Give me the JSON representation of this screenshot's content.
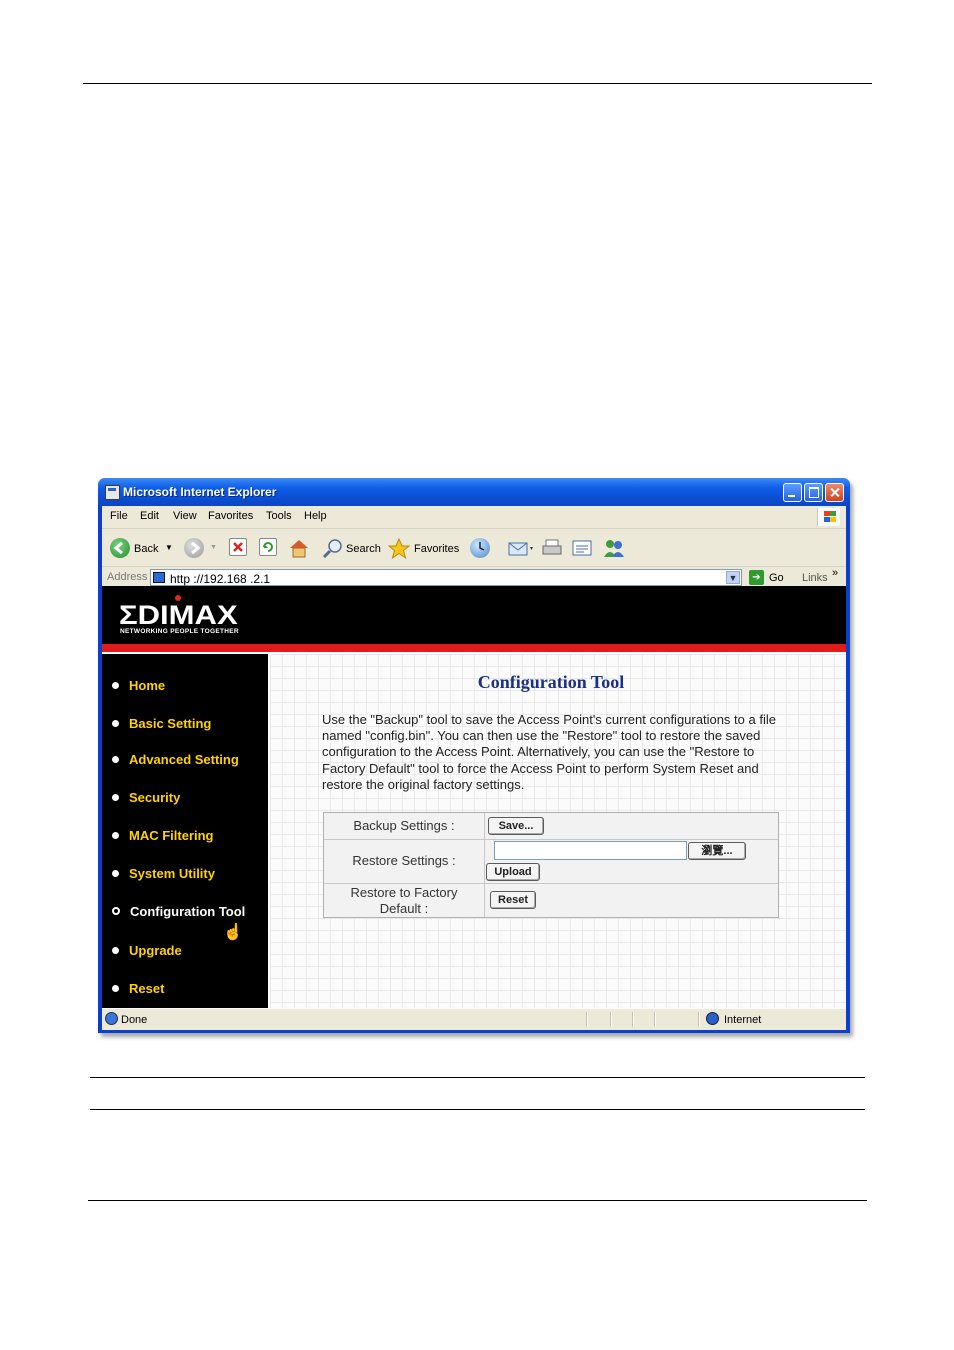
{
  "window": {
    "title": "Microsoft Internet Explorer"
  },
  "menu": [
    "File",
    "Edit",
    "View",
    "Favorites",
    "Tools",
    "Help"
  ],
  "toolbar": {
    "back_label": "Back",
    "search_label": "Search",
    "favorites_label": "Favorites"
  },
  "address": {
    "label": "Address",
    "url": "http ://192.168 .2.1",
    "go_label": "Go",
    "links_label": "Links",
    "links_chevron": "»"
  },
  "brand": {
    "logo_text": "ΣDIMAX",
    "tagline": "NETWORKING PEOPLE TOGETHER"
  },
  "nav": [
    {
      "label": "Home",
      "active": false
    },
    {
      "label": "Basic Setting",
      "active": false
    },
    {
      "label": "Advanced Setting",
      "active": false
    },
    {
      "label": "Security",
      "active": false
    },
    {
      "label": "MAC Filtering",
      "active": false
    },
    {
      "label": "System Utility",
      "active": false
    },
    {
      "label": "Configuration Tool",
      "active": true
    },
    {
      "label": "Upgrade",
      "active": false
    },
    {
      "label": "Reset",
      "active": false
    }
  ],
  "content": {
    "title": "Configuration Tool",
    "description": "Use the \"Backup\" tool to save the Access Point's current configurations to a file named \"config.bin\". You can then use the \"Restore\" tool to restore the saved configuration to the Access Point. Alternatively, you can use the \"Restore to Factory Default\" tool to force the Access Point to perform System Reset and restore the original factory settings.",
    "rows": {
      "backup_label": "Backup Settings :",
      "backup_button": "Save...",
      "restore_label": "Restore Settings :",
      "browse_button": "瀏覽...",
      "upload_button": "Upload",
      "factory_label_line1": "Restore to Factory",
      "factory_label_line2": "Default :",
      "reset_button": "Reset"
    }
  },
  "status": {
    "text": "Done",
    "zone": "Internet"
  }
}
